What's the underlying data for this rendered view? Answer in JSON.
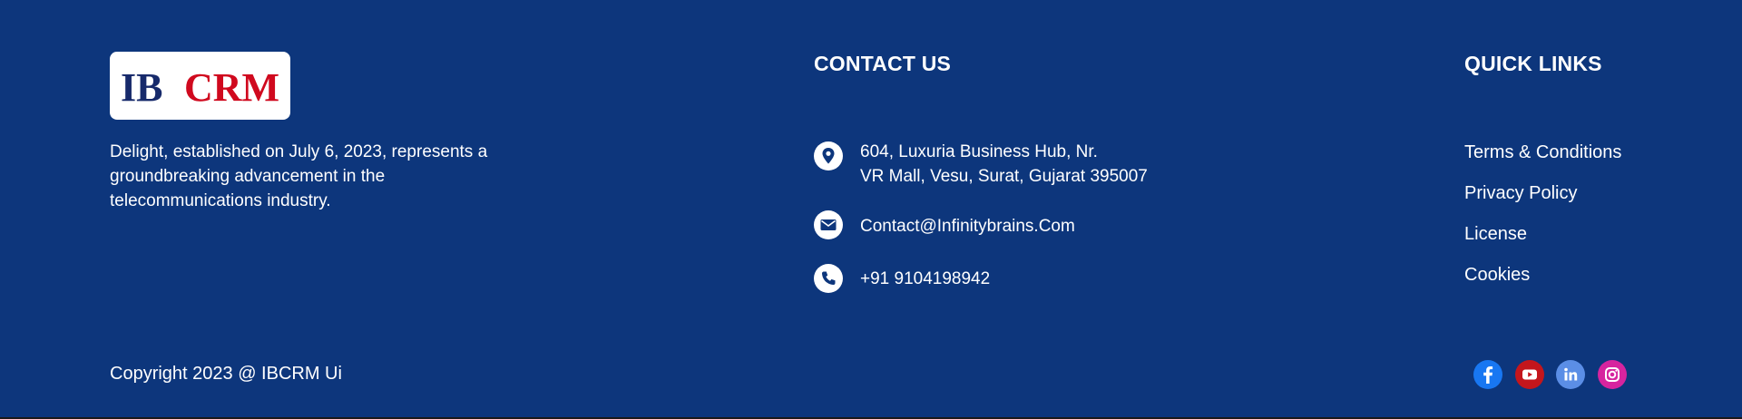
{
  "brand": {
    "logo_text_left": "IB",
    "logo_text_right": "CRM",
    "description": "Delight, established on July 6, 2023, represents a groundbreaking advancement in the telecommunications industry.",
    "colors": {
      "logo_navy": "#172a6b",
      "logo_red": "#d0091e"
    }
  },
  "contact": {
    "title": "CONTACT US",
    "address_line1": "604, Luxuria Business Hub, Nr.",
    "address_line2": "VR Mall, Vesu, Surat, Gujarat 395007",
    "email": "Contact@Infinitybrains.Com",
    "phone": "+91 9104198942",
    "icons": [
      "location-pin-icon",
      "mail-icon",
      "phone-icon"
    ]
  },
  "quick_links": {
    "title": "QUICK LINKS",
    "items": [
      {
        "label": "Terms & Conditions"
      },
      {
        "label": "Privacy Policy"
      },
      {
        "label": "License"
      },
      {
        "label": "Cookies"
      }
    ]
  },
  "bottom": {
    "copyright": "Copyright 2023 @ IBCRM Ui",
    "social": [
      {
        "name": "facebook-icon",
        "color": "#1877f2"
      },
      {
        "name": "youtube-icon",
        "color": "#c4161c"
      },
      {
        "name": "linkedin-icon",
        "color": "#5b8ee6"
      },
      {
        "name": "instagram-icon",
        "color": "#d6249f"
      }
    ]
  },
  "theme": {
    "background": "#0d367c",
    "text": "#ffffff"
  }
}
